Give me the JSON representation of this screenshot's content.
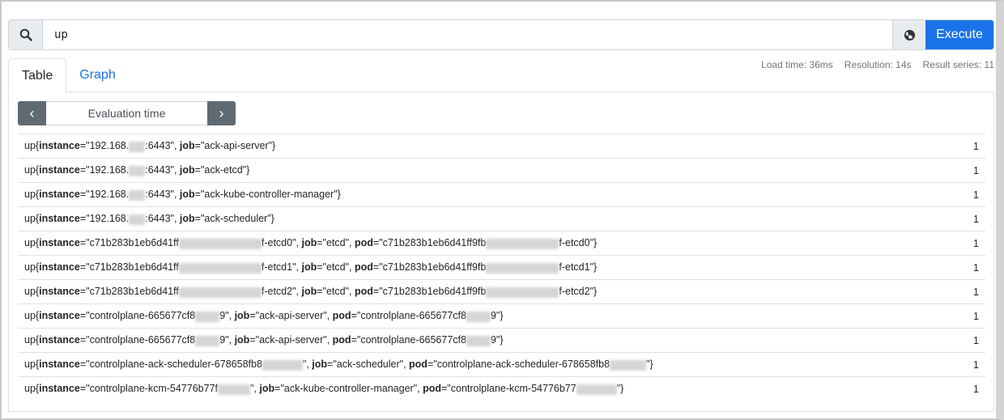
{
  "search": {
    "query": "up",
    "icon": "search-icon",
    "execute_label": "Execute",
    "globe_icon": "globe-icon"
  },
  "tabs": [
    {
      "label": "Table",
      "active": true
    },
    {
      "label": "Graph",
      "active": false
    }
  ],
  "stats": {
    "load_time": "Load time: 36ms",
    "resolution": "Resolution: 14s",
    "result_series": "Result series: 11"
  },
  "eval": {
    "placeholder": "Evaluation time",
    "prev_icon": "chevron-left-icon",
    "next_icon": "chevron-right-icon"
  },
  "colors": {
    "accent": "#1a73e8",
    "nav_button": "#5f6a72"
  },
  "results": [
    {
      "metric": "up",
      "labels": [
        {
          "name": "instance",
          "parts": [
            "192.168.",
            null,
            ":6443"
          ]
        },
        {
          "name": "job",
          "parts": [
            "ack-api-server"
          ]
        }
      ],
      "value": "1"
    },
    {
      "metric": "up",
      "labels": [
        {
          "name": "instance",
          "parts": [
            "192.168.",
            null,
            ":6443"
          ]
        },
        {
          "name": "job",
          "parts": [
            "ack-etcd"
          ]
        }
      ],
      "value": "1"
    },
    {
      "metric": "up",
      "labels": [
        {
          "name": "instance",
          "parts": [
            "192.168.",
            null,
            ":6443"
          ]
        },
        {
          "name": "job",
          "parts": [
            "ack-kube-controller-manager"
          ]
        }
      ],
      "value": "1"
    },
    {
      "metric": "up",
      "labels": [
        {
          "name": "instance",
          "parts": [
            "192.168.",
            null,
            ":6443"
          ]
        },
        {
          "name": "job",
          "parts": [
            "ack-scheduler"
          ]
        }
      ],
      "value": "1"
    },
    {
      "metric": "up",
      "labels": [
        {
          "name": "instance",
          "parts": [
            "c71b283b1eb6d41ff",
            null,
            "f-etcd0"
          ]
        },
        {
          "name": "job",
          "parts": [
            "etcd"
          ]
        },
        {
          "name": "pod",
          "parts": [
            "c71b283b1eb6d41ff9fb",
            null,
            "f-etcd0"
          ]
        }
      ],
      "value": "1"
    },
    {
      "metric": "up",
      "labels": [
        {
          "name": "instance",
          "parts": [
            "c71b283b1eb6d41ff",
            null,
            "f-etcd1"
          ]
        },
        {
          "name": "job",
          "parts": [
            "etcd"
          ]
        },
        {
          "name": "pod",
          "parts": [
            "c71b283b1eb6d41ff9fb",
            null,
            "f-etcd1"
          ]
        }
      ],
      "value": "1"
    },
    {
      "metric": "up",
      "labels": [
        {
          "name": "instance",
          "parts": [
            "c71b283b1eb6d41ff",
            null,
            "f-etcd2"
          ]
        },
        {
          "name": "job",
          "parts": [
            "etcd"
          ]
        },
        {
          "name": "pod",
          "parts": [
            "c71b283b1eb6d41ff9fb",
            null,
            "f-etcd2"
          ]
        }
      ],
      "value": "1"
    },
    {
      "metric": "up",
      "labels": [
        {
          "name": "instance",
          "parts": [
            "controlplane-665677cf8",
            null,
            "9"
          ]
        },
        {
          "name": "job",
          "parts": [
            "ack-api-server"
          ]
        },
        {
          "name": "pod",
          "parts": [
            "controlplane-665677cf8",
            null,
            "9"
          ]
        }
      ],
      "value": "1"
    },
    {
      "metric": "up",
      "labels": [
        {
          "name": "instance",
          "parts": [
            "controlplane-665677cf8",
            null,
            "9"
          ]
        },
        {
          "name": "job",
          "parts": [
            "ack-api-server"
          ]
        },
        {
          "name": "pod",
          "parts": [
            "controlplane-665677cf8",
            null,
            "9"
          ]
        }
      ],
      "value": "1"
    },
    {
      "metric": "up",
      "labels": [
        {
          "name": "instance",
          "parts": [
            "controlplane-ack-scheduler-678658fb8",
            null
          ]
        },
        {
          "name": "job",
          "parts": [
            "ack-scheduler"
          ]
        },
        {
          "name": "pod",
          "parts": [
            "controlplane-ack-scheduler-678658fb8",
            null
          ]
        }
      ],
      "value": "1"
    },
    {
      "metric": "up",
      "labels": [
        {
          "name": "instance",
          "parts": [
            "controlplane-kcm-54776b77f",
            null
          ]
        },
        {
          "name": "job",
          "parts": [
            "ack-kube-controller-manager"
          ]
        },
        {
          "name": "pod",
          "parts": [
            "controlplane-kcm-54776b77",
            null
          ]
        }
      ],
      "value": "1"
    }
  ]
}
